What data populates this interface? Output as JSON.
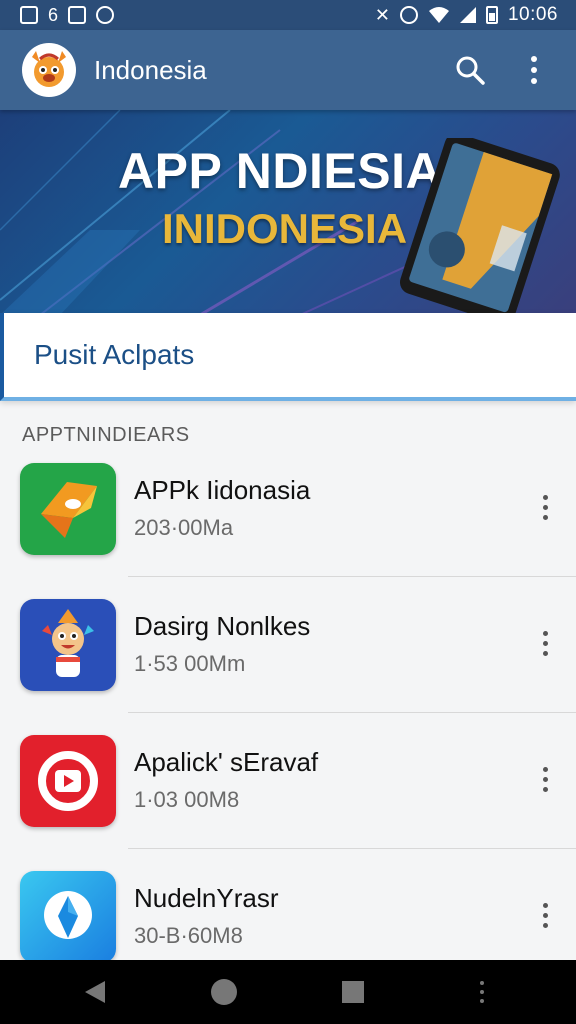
{
  "status_bar": {
    "left_text": "6",
    "time": "10:06",
    "icons": [
      "notification-icon",
      "image-icon",
      "shield-icon",
      "mute-icon",
      "alarm-icon",
      "wifi-icon",
      "signal-icon",
      "battery-icon"
    ]
  },
  "app_bar": {
    "title": "Indonesia",
    "icons": [
      "mascot-logo-icon",
      "search-icon",
      "more-vert-icon"
    ],
    "color": "#3d6491"
  },
  "banner": {
    "title": "APP NDIESIA",
    "subtitle": "INIDONESIA",
    "accent": "#e8b73a"
  },
  "search": {
    "label": "Pusit Aclpats"
  },
  "section": {
    "header": "APPTNINDIEARS"
  },
  "apps": [
    {
      "name": "APPk Iidonasia",
      "size": "203·00Ma",
      "icon": "green-folder-icon"
    },
    {
      "name": "Dasirg Nonlkes",
      "size": "1·53 00Mm",
      "icon": "mascot-app-icon"
    },
    {
      "name": "Apalick' sEravaf",
      "size": "1·03 00M8",
      "icon": "red-play-icon"
    },
    {
      "name": "NudelnYrasr",
      "size": "30-B·60M8",
      "icon": "blue-location-icon"
    }
  ],
  "nav_bar": {
    "icons": [
      "back-icon",
      "home-icon",
      "recents-icon",
      "more-icon"
    ]
  }
}
